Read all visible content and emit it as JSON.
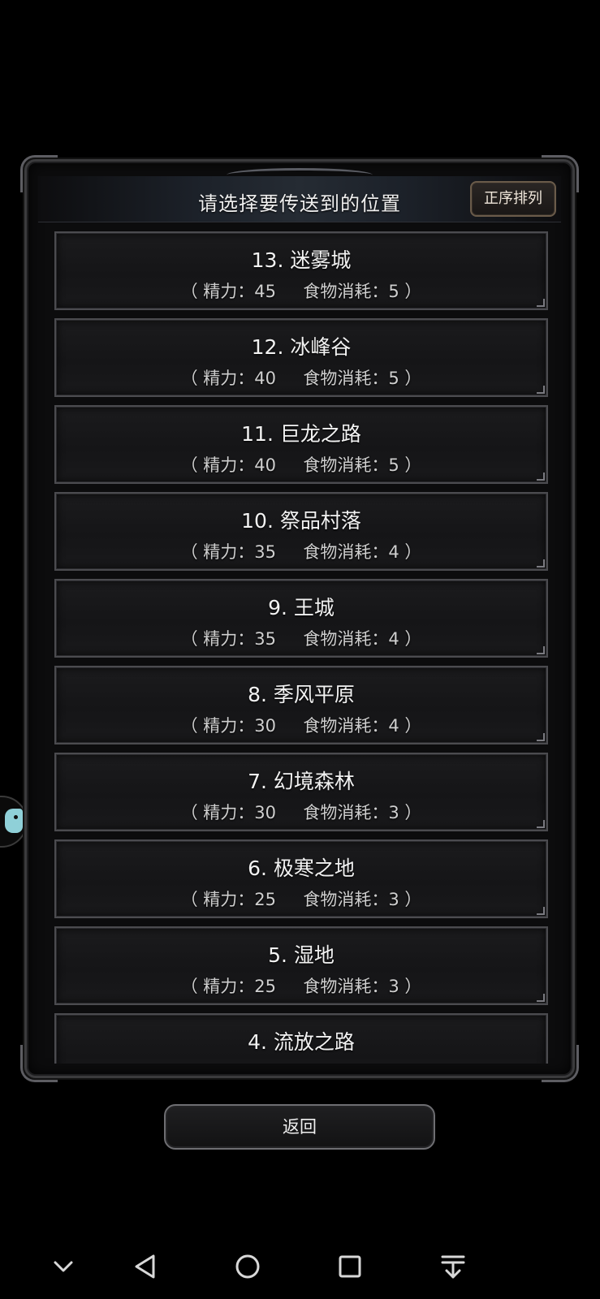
{
  "header": {
    "title": "请选择要传送到的位置",
    "sort_label": "正序排列"
  },
  "locations": [
    {
      "name": "13. 迷雾城",
      "cost": "（ 精力：45     食物消耗：5 ）"
    },
    {
      "name": "12. 冰峰谷",
      "cost": "（ 精力：40     食物消耗：5 ）"
    },
    {
      "name": "11. 巨龙之路",
      "cost": "（ 精力：40     食物消耗：5 ）"
    },
    {
      "name": "10. 祭品村落",
      "cost": "（ 精力：35     食物消耗：4 ）"
    },
    {
      "name": "9. 王城",
      "cost": "（ 精力：35     食物消耗：4 ）"
    },
    {
      "name": "8. 季风平原",
      "cost": "（ 精力：30     食物消耗：4 ）"
    },
    {
      "name": "7. 幻境森林",
      "cost": "（ 精力：30     食物消耗：3 ）"
    },
    {
      "name": "6. 极寒之地",
      "cost": "（ 精力：25     食物消耗：3 ）"
    },
    {
      "name": "5. 湿地",
      "cost": "（ 精力：25     食物消耗：3 ）"
    },
    {
      "name": "4. 流放之路",
      "cost": ""
    }
  ],
  "back_label": "返回",
  "navbar": {
    "icons": [
      "chevron-down-icon",
      "back-triangle-icon",
      "home-circle-icon",
      "recents-square-icon",
      "notification-pull-icon"
    ]
  }
}
